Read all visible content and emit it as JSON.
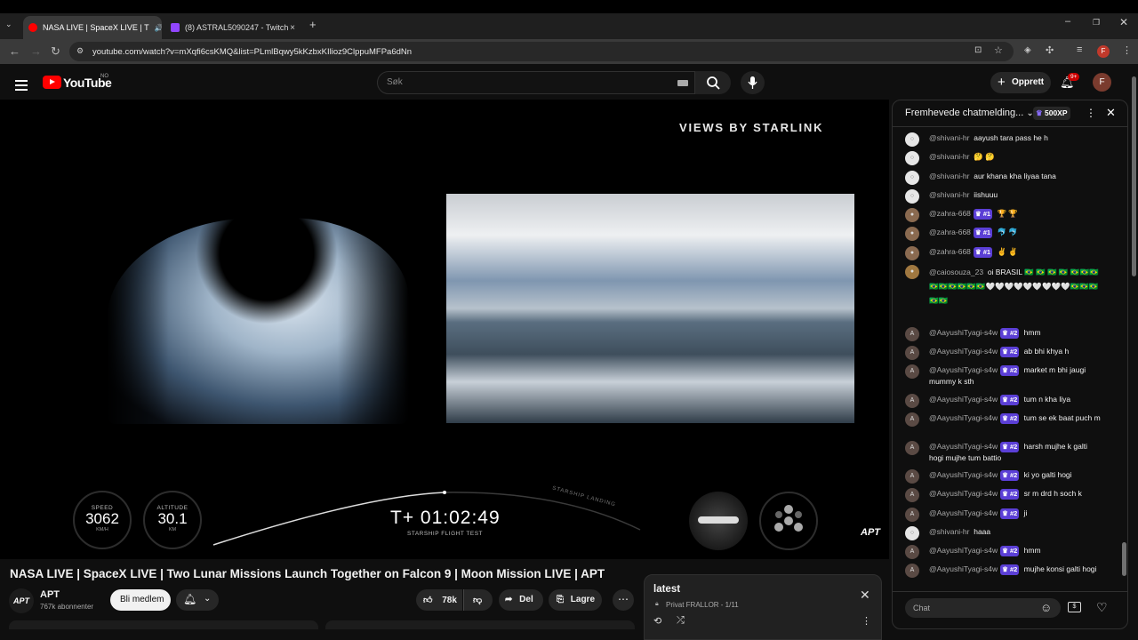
{
  "browser": {
    "tabs": [
      {
        "title": "NASA LIVE | SpaceX LIVE | T",
        "favicon": "youtube-icon",
        "close": "×"
      },
      {
        "title": "(8) ASTRAL5090247 - Twitch",
        "favicon": "twitch-icon",
        "close": "×"
      }
    ],
    "new_tab": "+",
    "url": "youtube.com/watch?v=mXqfi6csKMQ&list=PLmlBqwy5kKzbxKIlioz9ClppuMFPa6dNn"
  },
  "youtube": {
    "logo_text": "YouTube",
    "country": "NO",
    "search_placeholder": "Søk",
    "create_label": "Opprett",
    "notification_count": "9+",
    "avatar_letter": "F"
  },
  "video": {
    "overlay_title": "VIEWS BY STARLINK",
    "speed_label": "SPEED",
    "speed_value": "3062",
    "speed_unit": "KM/H",
    "altitude_label": "ALTITUDE",
    "altitude_value": "30.1",
    "altitude_unit": "KM",
    "timer": "T+ 01:02:49",
    "timer_sub": "STARSHIP FLIGHT TEST",
    "arc_label": "STARSHIP LANDING",
    "watermark": "APT",
    "title": "NASA LIVE | SpaceX LIVE | Two Lunar Missions Launch Together on Falcon 9 | Moon Mission LIVE | APT"
  },
  "channel": {
    "avatar_text": "APT",
    "name": "APT",
    "subscribers": "767k abonnenter",
    "join_label": "Bli medlem"
  },
  "actions": {
    "likes": "78k",
    "share": "Del",
    "save": "Lagre"
  },
  "playlist": {
    "title": "latest",
    "meta": "Privat FRALLOR - 1/11"
  },
  "chat": {
    "header": "Fremhevede chatmelding...",
    "xp": "500XP",
    "input_placeholder": "Chat",
    "messages": [
      {
        "author": "@shivani-hr",
        "badge": "",
        "text": "aayush tara pass he h"
      },
      {
        "author": "@shivani-hr",
        "badge": "",
        "text": "🤔 🤔"
      },
      {
        "author": "@shivani-hr",
        "badge": "",
        "text": "aur khana kha liyaa tana"
      },
      {
        "author": "@shivani-hr",
        "badge": "",
        "text": "iishuuu"
      },
      {
        "author": "@zahra-668",
        "badge": "#1",
        "text": "🏆 🏆"
      },
      {
        "author": "@zahra-668",
        "badge": "#1",
        "text": "🐬 🐬"
      },
      {
        "author": "@zahra-668",
        "badge": "#1",
        "text": "✌️ ✌️"
      },
      {
        "author": "@caiosouza_23",
        "badge": "",
        "text": "oi BRASIL 🇧🇷 🇧🇷 🇧🇷 🇧🇷 🇧🇷🇧🇷🇧🇷🇧🇷🇧🇷🇧🇷🇧🇷🇧🇷🇧🇷🤍🤍🤍🤍🤍🤍🤍🤍🤍🇧🇷🇧🇷🇧🇷🇧🇷🇧🇷"
      },
      {
        "author": "@AayushiTyagi-s4w",
        "badge": "#2",
        "text": "hmm"
      },
      {
        "author": "@AayushiTyagi-s4w",
        "badge": "#2",
        "text": "ab bhi khya h"
      },
      {
        "author": "@AayushiTyagi-s4w",
        "badge": "#2",
        "text": "market m bhi jaugi mummy k sth"
      },
      {
        "author": "@AayushiTyagi-s4w",
        "badge": "#2",
        "text": "tum n kha liya"
      },
      {
        "author": "@AayushiTyagi-s4w",
        "badge": "#2",
        "text": "tum se ek baat puch m"
      },
      {
        "author": "@AayushiTyagi-s4w",
        "badge": "#2",
        "text": "harsh mujhe k galti hogi mujhe tum battio"
      },
      {
        "author": "@AayushiTyagi-s4w",
        "badge": "#2",
        "text": "ki yo galti hogi"
      },
      {
        "author": "@AayushiTyagi-s4w",
        "badge": "#2",
        "text": "sr m drd h soch k"
      },
      {
        "author": "@AayushiTyagi-s4w",
        "badge": "#2",
        "text": "ji"
      },
      {
        "author": "@shivani-hr",
        "badge": "",
        "text": "haaa"
      },
      {
        "author": "@AayushiTyagi-s4w",
        "badge": "#2",
        "text": "hmm"
      },
      {
        "author": "@AayushiTyagi-s4w",
        "badge": "#2",
        "text": "mujhe konsi galti hogi"
      }
    ]
  },
  "colors": {
    "accent_red": "#ff0000",
    "badge_purple": "#5b3fd6"
  }
}
